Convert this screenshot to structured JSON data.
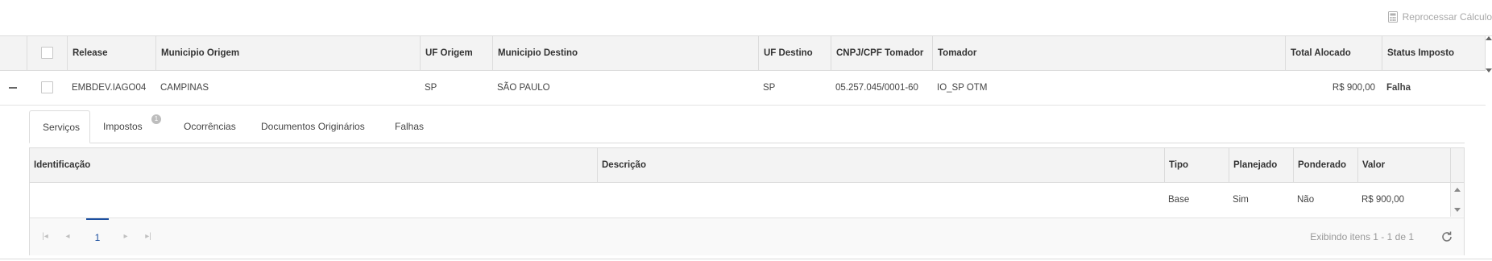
{
  "toolbar": {
    "reprocess_label": "Reprocessar Cálculo",
    "reprocess_icon": "calculator-icon"
  },
  "grid": {
    "columns": [
      "Release",
      "Municipio Origem",
      "UF Origem",
      "Municipio Destino",
      "UF Destino",
      "CNPJ/CPF Tomador",
      "Tomador",
      "Total Alocado",
      "Status Imposto"
    ],
    "row": {
      "release": "EMBDEV.IAGO04",
      "municipio_origem": "CAMPINAS",
      "uf_origem": "SP",
      "municipio_destino": "SÃO PAULO",
      "uf_destino": "SP",
      "cnpj_cpf_tomador": "05.257.045/0001-60",
      "tomador": "IO_SP OTM",
      "total_alocado": "R$ 900,00",
      "status_imposto": "Falha",
      "status_color": "#e0131c"
    }
  },
  "detail": {
    "tabs": [
      {
        "label": "Serviços",
        "active": true
      },
      {
        "label": "Impostos",
        "badge": "1"
      },
      {
        "label": "Ocorrências"
      },
      {
        "label": "Documentos Originários"
      },
      {
        "label": "Falhas"
      }
    ],
    "services": {
      "columns": [
        "Identificação",
        "Descrição",
        "Tipo",
        "Planejado",
        "Ponderado",
        "Valor"
      ],
      "row": {
        "identificacao": "",
        "descricao": "",
        "tipo": "Base",
        "planejado": "Sim",
        "ponderado": "Não",
        "valor": "R$ 900,00"
      }
    },
    "pager": {
      "current_page": "1",
      "info": "Exibindo itens 1 - 1 de 1"
    }
  },
  "colors": {
    "accent": "#1c4fa0",
    "failure": "#e0131c",
    "header_bg": "#f3f3f3"
  }
}
